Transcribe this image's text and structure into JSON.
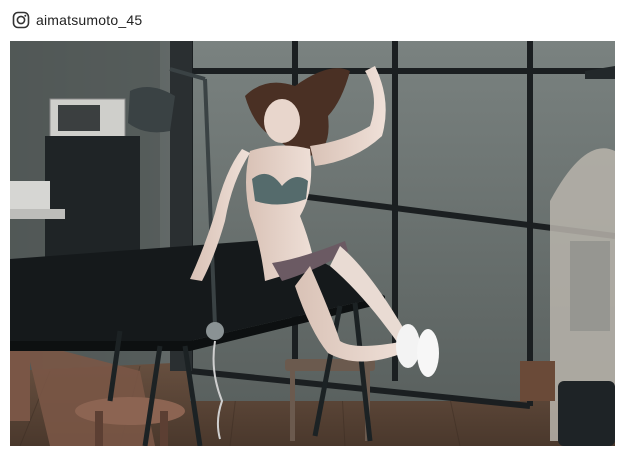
{
  "post": {
    "platform_icon": "instagram-icon",
    "username": "aimatsumoto_45"
  },
  "photo": {
    "colors": {
      "wall": "#646b69",
      "window_frame": "#1b1f21",
      "floor": "#6b5240",
      "table_top": "#161a1c",
      "lamp": "#3a4244"
    }
  }
}
